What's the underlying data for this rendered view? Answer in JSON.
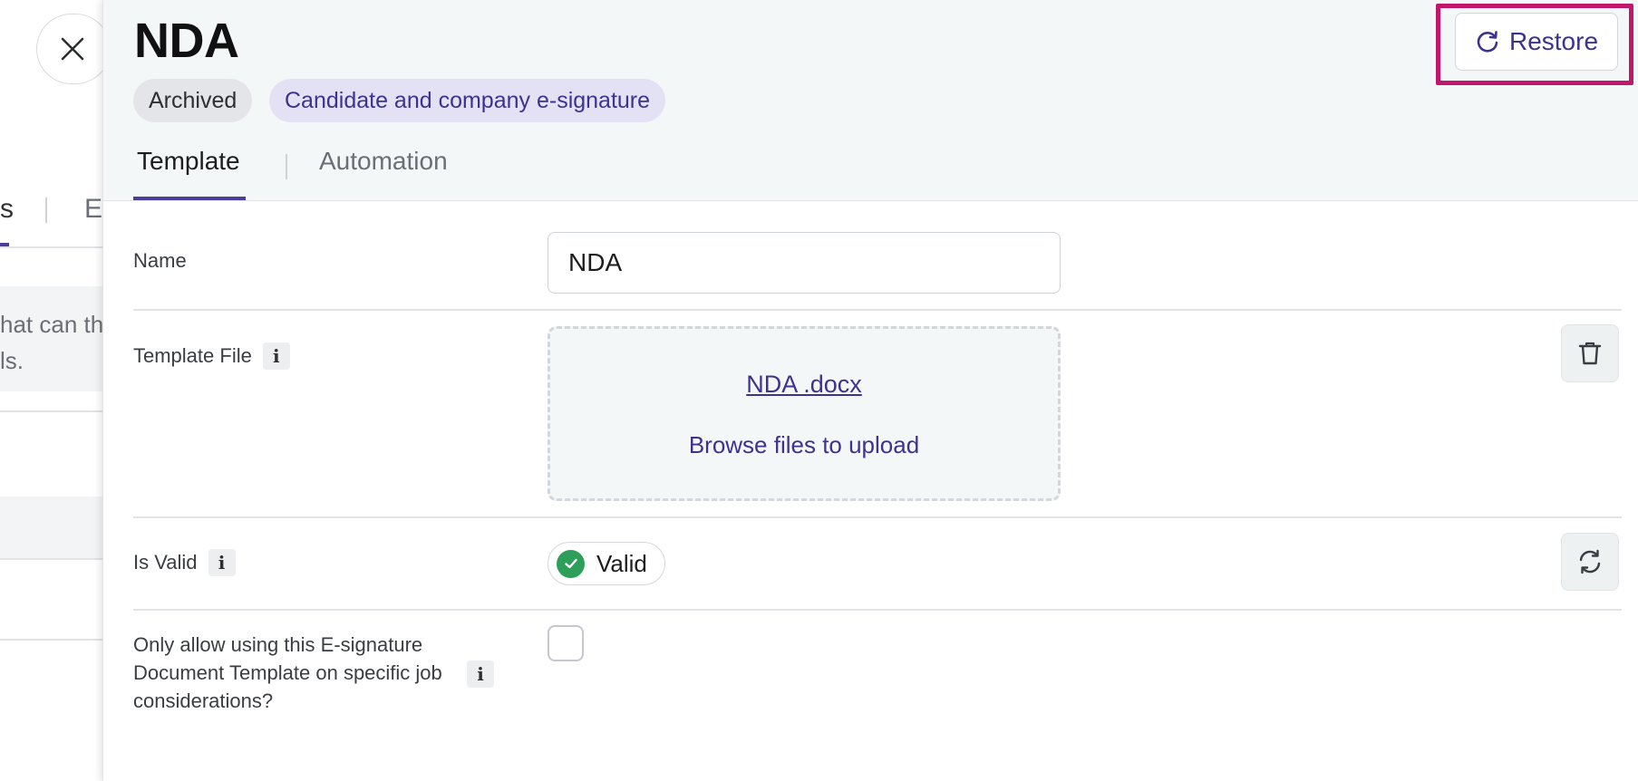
{
  "background": {
    "tab_partial_left": "s",
    "tab_partial_right": "E",
    "info_text_line1": "hat can th",
    "info_text_line2": "ls."
  },
  "panel": {
    "title": "NDA",
    "badges": [
      {
        "label": "Archived"
      },
      {
        "label": "Candidate and company e-signature"
      }
    ],
    "tabs": [
      {
        "label": "Template",
        "active": true
      },
      {
        "label": "Automation",
        "active": false
      }
    ],
    "restore_label": "Restore"
  },
  "form": {
    "name": {
      "label": "Name",
      "value": "NDA"
    },
    "template_file": {
      "label": "Template File",
      "info": "i",
      "file_name": "NDA .docx",
      "browse_label": "Browse files to upload"
    },
    "is_valid": {
      "label": "Is Valid",
      "info": "i",
      "status": "Valid"
    },
    "only_allow": {
      "label": "Only allow using this E-signature Document Template on specific job considerations?",
      "info": "i",
      "checked": false
    }
  },
  "colors": {
    "accent": "#3c3390",
    "highlight_outline": "#c0166b",
    "valid_green": "#2e9e5b"
  },
  "icons": [
    "close-icon",
    "restore-icon",
    "trash-icon",
    "refresh-icon",
    "check-icon",
    "info-icon"
  ]
}
